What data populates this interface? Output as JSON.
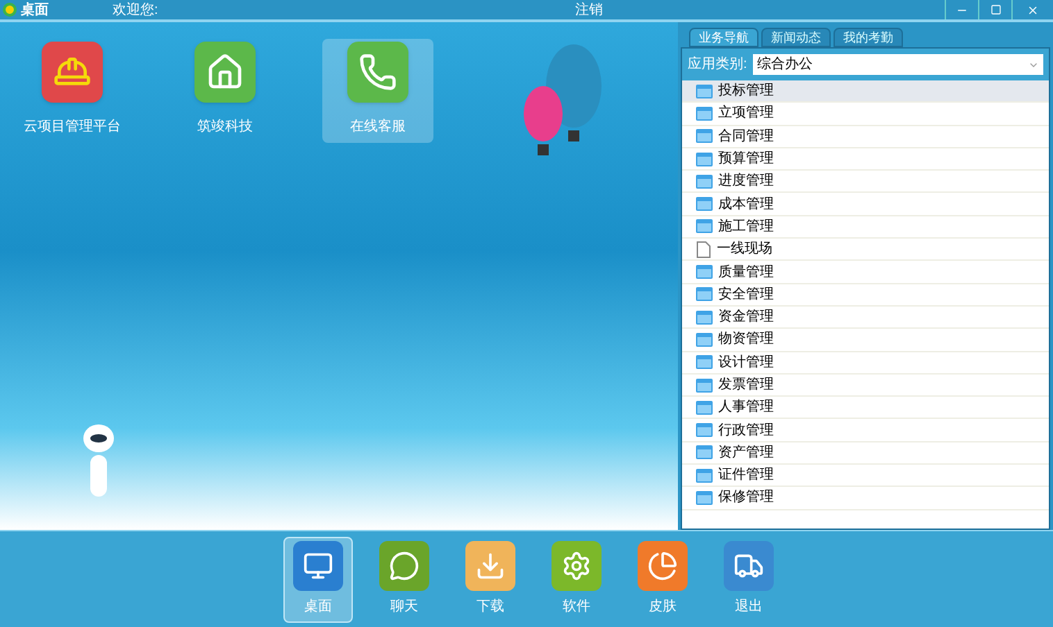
{
  "title_bar": {
    "app_name": "桌面",
    "welcome": "欢迎您:",
    "logout": "注销"
  },
  "desktop_icons": [
    {
      "label": "云项目管理平台",
      "kind": "helmet",
      "selected": false
    },
    {
      "label": "筑竣科技",
      "kind": "house",
      "selected": false
    },
    {
      "label": "在线客服",
      "kind": "phone",
      "selected": true
    }
  ],
  "panel": {
    "tabs": [
      {
        "label": "业务导航",
        "selected": true
      },
      {
        "label": "新闻动态",
        "selected": false
      },
      {
        "label": "我的考勤",
        "selected": false
      }
    ],
    "category_label": "应用类别:",
    "category_value": "综合办公",
    "items": [
      {
        "label": "投标管理",
        "kind": "folder",
        "selected": true
      },
      {
        "label": "立项管理",
        "kind": "folder",
        "selected": false
      },
      {
        "label": "合同管理",
        "kind": "folder",
        "selected": false
      },
      {
        "label": "预算管理",
        "kind": "folder",
        "selected": false
      },
      {
        "label": "进度管理",
        "kind": "folder",
        "selected": false
      },
      {
        "label": "成本管理",
        "kind": "folder",
        "selected": false
      },
      {
        "label": "施工管理",
        "kind": "folder",
        "selected": false
      },
      {
        "label": "一线现场",
        "kind": "file",
        "selected": false
      },
      {
        "label": "质量管理",
        "kind": "folder",
        "selected": false
      },
      {
        "label": "安全管理",
        "kind": "folder",
        "selected": false
      },
      {
        "label": "资金管理",
        "kind": "folder",
        "selected": false
      },
      {
        "label": "物资管理",
        "kind": "folder",
        "selected": false
      },
      {
        "label": "设计管理",
        "kind": "folder",
        "selected": false
      },
      {
        "label": "发票管理",
        "kind": "folder",
        "selected": false
      },
      {
        "label": "人事管理",
        "kind": "folder",
        "selected": false
      },
      {
        "label": "行政管理",
        "kind": "folder",
        "selected": false
      },
      {
        "label": "资产管理",
        "kind": "folder",
        "selected": false
      },
      {
        "label": "证件管理",
        "kind": "folder",
        "selected": false
      },
      {
        "label": "保修管理",
        "kind": "folder",
        "selected": false
      }
    ]
  },
  "dock": [
    {
      "label": "桌面",
      "kind": "desktop",
      "selected": true
    },
    {
      "label": "聊天",
      "kind": "chat",
      "selected": false
    },
    {
      "label": "下载",
      "kind": "download",
      "selected": false
    },
    {
      "label": "软件",
      "kind": "soft",
      "selected": false
    },
    {
      "label": "皮肤",
      "kind": "pie",
      "selected": false
    },
    {
      "label": "退出",
      "kind": "truck",
      "selected": false
    }
  ]
}
